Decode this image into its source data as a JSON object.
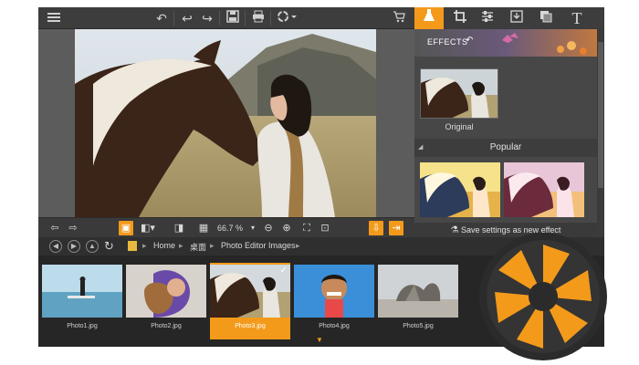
{
  "toolbar": {
    "icons": [
      "menu-icon",
      "rotate-icon",
      "undo-icon",
      "redo-icon",
      "save-icon",
      "print-icon",
      "share-icon"
    ]
  },
  "right_tabs": [
    "cart-icon",
    "effects-icon",
    "crop-icon",
    "adjust-icon",
    "export-icon",
    "layers-icon",
    "text-icon"
  ],
  "zoom_level": "66.7 %",
  "effects": {
    "title": "EFFECTS",
    "original_label": "Original",
    "popular_label": "Popular",
    "save_label": "Save settings as new effect"
  },
  "browser": {
    "breadcrumb": [
      "Home",
      "桌面",
      "Photo Editor Images"
    ]
  },
  "files": [
    {
      "name": "Photo1.jpg",
      "selected": false
    },
    {
      "name": "Photo2.jpg",
      "selected": false
    },
    {
      "name": "Photo3.jpg",
      "selected": true
    },
    {
      "name": "Photo4.jpg",
      "selected": false
    },
    {
      "name": "Photo5.jpg",
      "selected": false
    }
  ],
  "colors": {
    "accent": "#f39a1b",
    "panel": "#3a3a3a",
    "strip": "#262626"
  }
}
